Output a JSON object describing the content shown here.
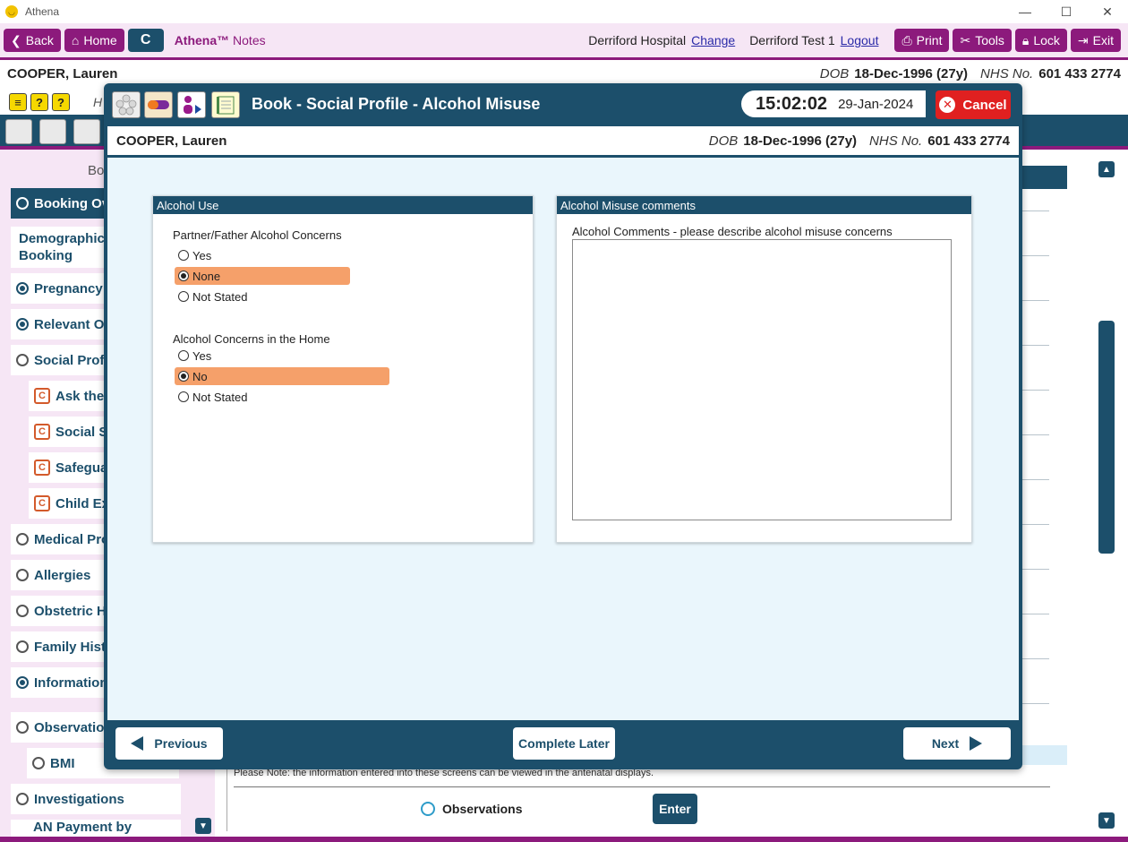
{
  "window": {
    "title": "Athena",
    "controls": [
      "—",
      "☐",
      "✕"
    ]
  },
  "toolbar": {
    "back": "Back",
    "home": "Home",
    "c": "C",
    "brand": "Athena™",
    "brand_suffix": "Notes",
    "hospital": "Derriford Hospital",
    "change": "Change",
    "user": "Derriford Test 1",
    "logout": "Logout",
    "print": "Print",
    "tools": "Tools",
    "lock": "Lock",
    "exit": "Exit"
  },
  "patient": {
    "name": "COOPER, Lauren",
    "dob_label": "DOB",
    "dob": "18-Dec-1996 (27y)",
    "nhs_label": "NHS No.",
    "nhs": "601 433 2774"
  },
  "background": {
    "h_label": "H",
    "nav_header": "Bo",
    "nav": [
      {
        "label": "Booking Ov",
        "state": "active"
      },
      {
        "label": "Demographics",
        "label2": "Booking",
        "state": "none"
      },
      {
        "label": "Pregnancy I",
        "state": "filled"
      },
      {
        "label": "Relevant Ot",
        "state": "filled"
      },
      {
        "label": "Social Profil",
        "state": "empty"
      },
      {
        "label": "Ask the",
        "state": "c"
      },
      {
        "label": "Social Se",
        "state": "c"
      },
      {
        "label": "Safegua",
        "state": "c"
      },
      {
        "label": "Child Exp",
        "state": "c"
      },
      {
        "label": "Medical Pro",
        "state": "empty"
      },
      {
        "label": "Allergies",
        "state": "empty"
      },
      {
        "label": "Obstetric H",
        "state": "empty"
      },
      {
        "label": "Family Histo",
        "state": "empty"
      },
      {
        "label": "Information",
        "state": "filled"
      },
      {
        "label": "Observation",
        "state": "empty"
      },
      {
        "label": "BMI",
        "state": "empty"
      },
      {
        "label": "Investigations",
        "state": "empty"
      },
      {
        "label": "AN Payment by",
        "state": "empty"
      }
    ],
    "note": "Please Note: the information entered into these screens can be viewed in the antenatal displays.",
    "observations": "Observations",
    "enter": "Enter"
  },
  "modal": {
    "title": "Book - Social Profile - Alcohol Misuse",
    "time": "15:02:02",
    "date": "29-Jan-2024",
    "cancel": "Cancel",
    "left_panel": {
      "header": "Alcohol Use",
      "q1": {
        "label": "Partner/Father Alcohol Concerns",
        "options": [
          "Yes",
          "None",
          "Not Stated"
        ],
        "selected": "None"
      },
      "q2": {
        "label": "Alcohol Concerns in the Home",
        "options": [
          "Yes",
          "No",
          "Not Stated"
        ],
        "selected": "No"
      }
    },
    "right_panel": {
      "header": "Alcohol Misuse comments",
      "comments_label": "Alcohol Comments - please describe alcohol misuse concerns",
      "comments_value": ""
    },
    "footer": {
      "previous": "Previous",
      "complete_later": "Complete Later",
      "next": "Next"
    }
  },
  "colors": {
    "primary": "#1c4f6b",
    "accent": "#8c1a7c",
    "selected": "#f5a06a",
    "cancel": "#e02020"
  }
}
